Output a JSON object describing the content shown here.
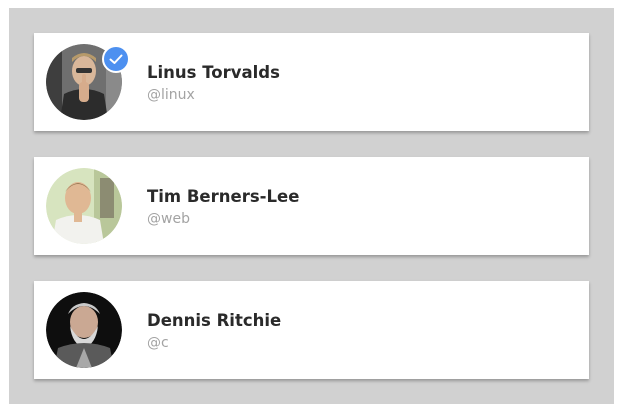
{
  "users": [
    {
      "name": "Linus Torvalds",
      "handle": "@linux",
      "avatar_icon": "linus-torvalds-avatar",
      "verified": true,
      "verified_color": "#4d90f0"
    },
    {
      "name": "Tim Berners-Lee",
      "handle": "@web",
      "avatar_icon": "tim-berners-lee-avatar",
      "verified": false
    },
    {
      "name": "Dennis Ritchie",
      "handle": "@c",
      "avatar_icon": "dennis-ritchie-avatar",
      "verified": false
    }
  ],
  "colors": {
    "panel_background": "#d1d1d1",
    "card_background": "#ffffff",
    "name_text": "#2a2a2a",
    "handle_text": "#a3a3a3"
  }
}
